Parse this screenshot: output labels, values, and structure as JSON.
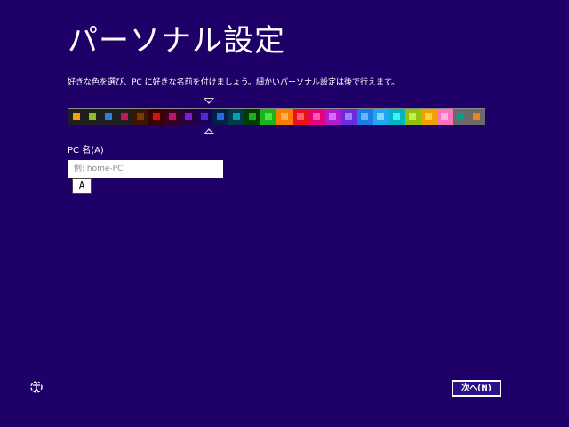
{
  "header": {
    "title": "パーソナル設定",
    "description": "好きな色を選び、PC に好きな名前を付けましょう。細かいパーソナル設定は後で行えます。"
  },
  "color_picker": {
    "selected_index": 10,
    "swatches": [
      {
        "bg": "#1f1f1f",
        "dot": "#f0a30a"
      },
      {
        "bg": "#1f1f1f",
        "dot": "#8cbf26"
      },
      {
        "bg": "#1f1f1f",
        "dot": "#2d7fd8"
      },
      {
        "bg": "#1f1f1f",
        "dot": "#c2185b"
      },
      {
        "bg": "#3a1500",
        "dot": "#7a3b00"
      },
      {
        "bg": "#3b0000",
        "dot": "#d01212"
      },
      {
        "bg": "#3a0020",
        "dot": "#c0126f"
      },
      {
        "bg": "#26003f",
        "dot": "#7a1fd0"
      },
      {
        "bg": "#1c0058",
        "dot": "#4a2ae0"
      },
      {
        "bg": "#00204a",
        "dot": "#1e6fd9"
      },
      {
        "bg": "#003a48",
        "dot": "#00a0b0"
      },
      {
        "bg": "#003b00",
        "dot": "#1fae1f"
      },
      {
        "bg": "#1bb51b",
        "dot": "#4ee24e"
      },
      {
        "bg": "#ff7a00",
        "dot": "#ffb050"
      },
      {
        "bg": "#e81123",
        "dot": "#ff6060"
      },
      {
        "bg": "#e3007a",
        "dot": "#ff5cb0"
      },
      {
        "bg": "#b01ad0",
        "dot": "#d070ff"
      },
      {
        "bg": "#6a2ae0",
        "dot": "#a080ff"
      },
      {
        "bg": "#1e7be0",
        "dot": "#60b8ff"
      },
      {
        "bg": "#1ea6f0",
        "dot": "#80d8ff"
      },
      {
        "bg": "#00b4c0",
        "dot": "#40f0f0"
      },
      {
        "bg": "#90c010",
        "dot": "#c8f040"
      },
      {
        "bg": "#f0a000",
        "dot": "#ffd040"
      },
      {
        "bg": "#ff70c0",
        "dot": "#ffb0e0"
      },
      {
        "bg": "#6a6a6a",
        "dot": "#00a08a"
      },
      {
        "bg": "#6a6a6a",
        "dot": "#f08020"
      }
    ]
  },
  "pc_name": {
    "label": "PC 名(A)",
    "placeholder": "例: home-PC",
    "value": "",
    "ime_mode": "A"
  },
  "footer": {
    "next_label": "次へ(N)"
  }
}
